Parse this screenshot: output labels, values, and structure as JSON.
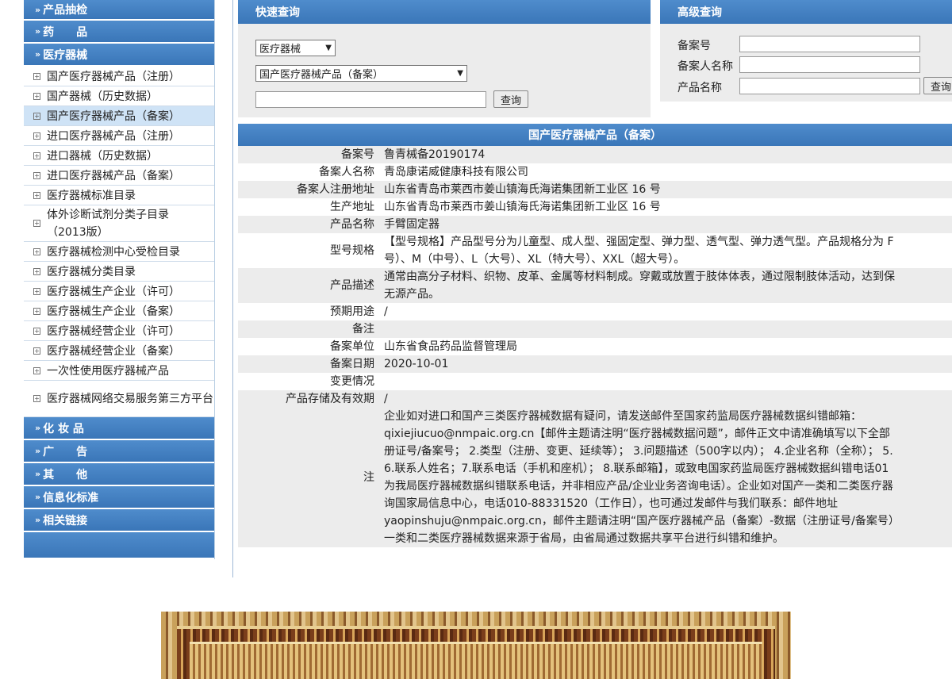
{
  "sidebar": {
    "categories_top": [
      {
        "label": "产品抽检"
      },
      {
        "label": "药　　品"
      },
      {
        "label": "医疗器械"
      }
    ],
    "items": [
      {
        "label": "国产医疗器械产品（注册）"
      },
      {
        "label": "国产器械（历史数据）"
      },
      {
        "label": "国产医疗器械产品（备案）"
      },
      {
        "label": "进口医疗器械产品（注册）"
      },
      {
        "label": "进口器械（历史数据）"
      },
      {
        "label": "进口医疗器械产品（备案）"
      },
      {
        "label": "医疗器械标准目录"
      },
      {
        "label": "体外诊断试剂分类子目录（2013版）"
      },
      {
        "label": "医疗器械检测中心受检目录"
      },
      {
        "label": "医疗器械分类目录"
      },
      {
        "label": "医疗器械生产企业（许可）"
      },
      {
        "label": "医疗器械生产企业（备案）"
      },
      {
        "label": "医疗器械经营企业（许可）"
      },
      {
        "label": "医疗器械经营企业（备案）"
      },
      {
        "label": "一次性使用医疗器械产品"
      },
      {
        "label": "医疗器械网络交易服务第三方平台"
      }
    ],
    "categories_bottom": [
      {
        "label": "化 妆 品"
      },
      {
        "label": "广　　告"
      },
      {
        "label": "其　　他"
      },
      {
        "label": "信息化标准"
      },
      {
        "label": "相关链接"
      }
    ],
    "arrow": "»",
    "expander": "⊞"
  },
  "quick": {
    "title": "快速查询",
    "select1": "医疗器械",
    "select2": "国产医疗器械产品（备案）",
    "input_value": "",
    "button": "查询"
  },
  "advanced": {
    "title": "高级查询",
    "label1": "备案号",
    "label2": "备案人名称",
    "label3": "产品名称",
    "button": "查询"
  },
  "detail": {
    "title": "国产医疗器械产品（备案）",
    "rows": [
      {
        "label": "备案号",
        "value": "鲁青械备20190174"
      },
      {
        "label": "备案人名称",
        "value": "青岛康诺威健康科技有限公司"
      },
      {
        "label": "备案人注册地址",
        "value": "山东省青岛市莱西市姜山镇海氏海诺集团新工业区 16 号"
      },
      {
        "label": "生产地址",
        "value": "山东省青岛市莱西市姜山镇海氏海诺集团新工业区 16 号"
      },
      {
        "label": "产品名称",
        "value": "手臂固定器"
      },
      {
        "label": "型号规格",
        "value": "【型号规格】产品型号分为儿童型、成人型、强固定型、弹力型、透气型、弹力透气型。产品规格分为 F\n号）、M（中号）、L（大号）、XL（特大号）、XXL（超大号）。"
      },
      {
        "label": "产品描述",
        "value": "通常由高分子材料、织物、皮革、金属等材料制成。穿戴或放置于肢体体表，通过限制肢体活动，达到保\n无源产品。"
      },
      {
        "label": "预期用途",
        "value": "/"
      },
      {
        "label": "备注",
        "value": ""
      },
      {
        "label": "备案单位",
        "value": "山东省食品药品监督管理局"
      },
      {
        "label": "备案日期",
        "value": "2020-10-01"
      },
      {
        "label": "变更情况",
        "value": ""
      },
      {
        "label": "产品存储及有效期",
        "value": "/"
      },
      {
        "label": "注",
        "value": "企业如对进口和国产三类医疗器械数据有疑问，请发送邮件至国家药监局医疗器械数据纠错邮箱：\nqixiejiucuo@nmpaic.org.cn【邮件主题请注明“医疗器械数据问题”，邮件正文中请准确填写以下全部\n册证号/备案号； 2.类型（注册、变更、延续等）； 3.问题描述（500字以内）； 4.企业名称（全称）； 5.\n6.联系人姓名；7.联系电话（手机和座机）； 8.联系邮箱】，或致电国家药监局医疗器械数据纠错电话01\n为我局医疗器械数据纠错联系电话，并非相应产品/企业业务咨询电话）。企业如对国产一类和二类医疗器\n询国家局信息中心，电话010-88331520（工作日），也可通过发邮件与我们联系：邮件地址\nyaopinshuju@nmpaic.org.cn，邮件主题请注明“国产医疗器械产品（备案）-数据（注册证号/备案号）\n一类和二类医疗器械数据来源于省局，由省局通过数据共享平台进行纠错和维护。"
      }
    ]
  }
}
